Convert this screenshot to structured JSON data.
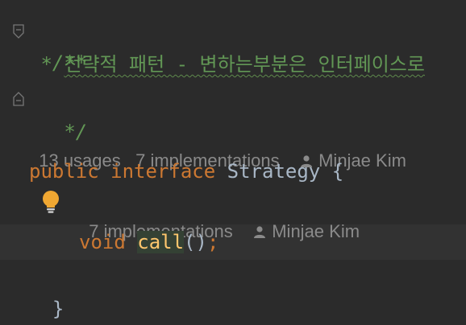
{
  "editor": {
    "doc_open": "/**",
    "doc_prefix": " * ",
    "doc_text": "전략적 패턴 - 변하는부분은 인터페이스로",
    "doc_close": " */",
    "usages_hint": "13 usages",
    "impl_hint_1": "7 implementations",
    "author_hint_1": "Minjae Kim",
    "kw_public": "public",
    "kw_interface": "interface",
    "class_name": "Strategy",
    "open_brace": "{",
    "impl_hint_2": "7 implementations",
    "author_hint_2": "Minjae Kim",
    "kw_void": "void",
    "method_name": "call",
    "parens": "()",
    "semicolon": ";",
    "close_brace": "}"
  },
  "colors": {
    "background": "#2b2b2b",
    "doc_comment": "#629755",
    "keyword": "#cc7832",
    "method": "#ffc66d",
    "hint_text": "#8a8a8a",
    "bulb": "#f0a732"
  },
  "icons": [
    "fold-start-icon",
    "fold-end-icon",
    "person-icon",
    "lightbulb-icon"
  ]
}
